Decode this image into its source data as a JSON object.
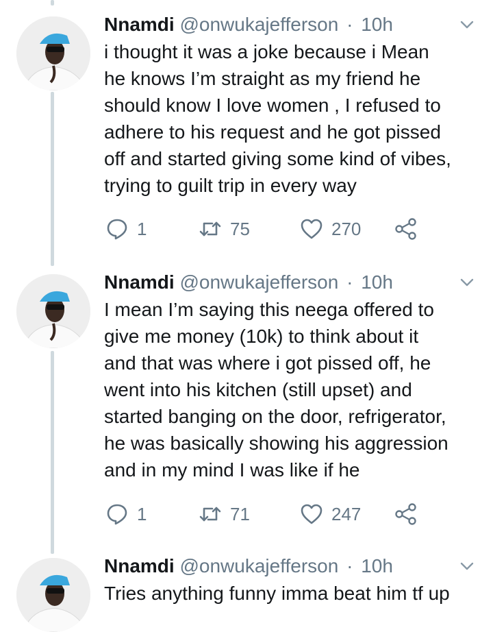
{
  "tweets": [
    {
      "name": "Nnamdi",
      "handle": "@onwukajefferson",
      "separator": "·",
      "time": "10h",
      "text": "i thought it was a joke because i Mean\nhe knows I’m straight as my friend he\nshould know I love women , I refused to\nadhere to his request and he got pissed\noff and started giving some kind of vibes,\ntrying to guilt trip in every way",
      "replies": "1",
      "retweets": "75",
      "likes": "270"
    },
    {
      "name": "Nnamdi",
      "handle": "@onwukajefferson",
      "separator": "·",
      "time": "10h",
      "text": "I mean I’m saying this neega offered to\ngive me money (10k) to think about it\nand that was where i got pissed off, he\nwent into his kitchen (still upset) and\nstarted banging on the door, refrigerator,\nhe was basically showing his aggression\nand in my mind I was like if he",
      "replies": "1",
      "retweets": "71",
      "likes": "247"
    },
    {
      "name": "Nnamdi",
      "handle": "@onwukajefferson",
      "separator": "·",
      "time": "10h",
      "text": "Tries anything funny imma beat him tf up"
    }
  ],
  "icons": {
    "reply": "reply-icon",
    "retweet": "retweet-icon",
    "like": "heart-icon",
    "share": "share-icon",
    "caret": "chevron-down-icon"
  },
  "colors": {
    "text": "#14171a",
    "secondary": "#657786",
    "thread_line": "#cfd9de",
    "avatar_cap": "#3aa7dd"
  }
}
